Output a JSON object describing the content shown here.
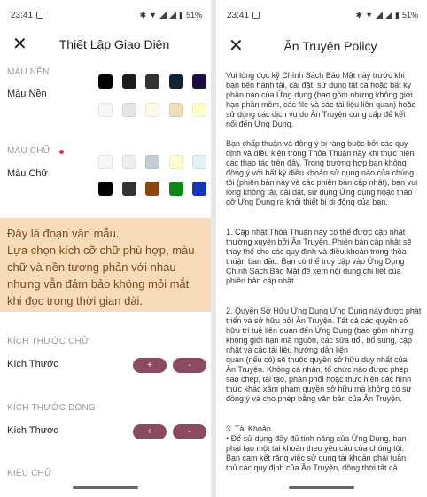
{
  "left": {
    "status": {
      "time": "23:41",
      "battery": "51%"
    },
    "title": "Thiết Lập Giao Diện",
    "bg_section": "MÀU NỀN",
    "bg_label": "Màu Nền",
    "text_section": "MÀU CHỮ",
    "text_label": "Màu Chữ",
    "bg_colors_row1": [
      "#000000",
      "#1a1a1a",
      "#333333",
      "#102338",
      "#1e0d42"
    ],
    "bg_colors_row2": [
      "#f7f7f7",
      "#e6e6e6",
      "#fff8e6",
      "#f3dcb9",
      "#ffffcc"
    ],
    "text_colors_row1": [
      "#f7f7f7",
      "#eeeeee",
      "#c5cfd3",
      "#ffffcc",
      "#dff4f4"
    ],
    "text_colors_row2": [
      "#000000",
      "#333333",
      "#8b4513",
      "#0a8a12",
      "#1534b8"
    ],
    "sample_lines": [
      "Đây là đoạn văn mẫu.",
      "Lựa chọn kích cỡ chữ phù hợp, màu",
      "chữ và nền tương phản với nhau",
      "nhưng vẫn đảm bảo không mỏi mắt",
      "khi đọc trong thời gian dài."
    ],
    "font_size_section": "KÍCH THƯỚC CHỮ",
    "font_size_label": "Kích Thước",
    "line_size_section": "KÍCH THƯỚC DÒNG",
    "line_size_label": "Kích Thước",
    "font_style_section": "KIỂU CHỮ",
    "plus": "+",
    "minus": "-",
    "colors": {
      "sample_bg": "#f8dcb9",
      "sample_text": "#7a4a1f",
      "button": "#8a4a60"
    }
  },
  "right": {
    "status": {
      "time": "23:41",
      "battery": "51%"
    },
    "title": "Ăn Truyện Policy",
    "p1": [
      "Vui lòng đọc kỹ Chính Sách Bảo Mật này trước khi",
      "bạn tiến hành tải, cài đặt, sử dụng tất cả hoặc bất kỳ",
      "phần nào của Ứng dụng (bao gồm nhưng không giới",
      "hạn phần mềm, các file và các tài liệu liên quan) hoặc",
      "sử dụng các dịch vụ do Ăn Truyện cung cấp để kết",
      "nối đến Ứng Dụng."
    ],
    "p2": [
      "Bạn chấp thuận và đồng ý bị ràng buộc bởi các quy",
      "định và điều kiện trong Thỏa Thuận này khi thực hiện",
      "các thao tác trên đây. Trong trường hợp bạn không",
      "đồng ý với bất kỳ điều khoản sử dụng nào của chúng",
      "tôi (phiên bản này và các phiên bản cập nhật), bạn vui",
      "lòng không tải, cài đặt, sử dụng Ứng dụng hoặc tháo",
      "gỡ Ứng Dụng ra khỏi thiết bị di động của bạn."
    ],
    "p3": [
      "1. Cập nhật Thỏa Thuận này có thể được cập nhật",
      "thường xuyên bởi Ăn Truyện. Phiên bản cập nhật sẽ",
      "thay thế cho các quy định và điều khoản trong thỏa",
      "thuận ban đầu. Bạn có thể truy cập vào Ứng Dụng",
      "Chính Sách Bảo Mật để xem nội dung chi tiết của",
      "phiên bản cập nhật."
    ],
    "p4": [
      "2. Quyền Sở Hữu Ứng Dụng Ứng Dụng này được phát",
      "triển và sở hữu bởi Ăn Truyện. Tất cả các quyền sở",
      "hữu trí tuệ liên quan đến Ứng Dụng (bao gồm nhưng",
      "không giới hạn mã nguồn, các sửa đổi, bổ sung, cập",
      "nhật và các tài liệu hướng dẫn liên",
      "quan (nếu có) sẽ thuộc quyền sở hữu duy nhất của",
      "Ăn Truyện. Không cá nhân, tổ chức nào được phép",
      "sao chép, tái tạo, phân phối hoặc thực hiện các hình",
      "thức khác xâm phạm quyền sở hữu mà không có sự",
      "đồng ý và cho phép bằng văn bản của Ăn Truyện."
    ],
    "p5": [
      "3. Tài Khoản",
      "• Để sử dụng đầy đủ tính năng của Ứng Dụng, bạn",
      "phải tạo một tài khoản theo yêu cầu của chúng tôi.",
      "Bạn cam kết rằng việc sử dụng tài khoản phải tuân",
      "thủ các quy định của Ăn Truyện, đồng thời tất cả"
    ]
  }
}
